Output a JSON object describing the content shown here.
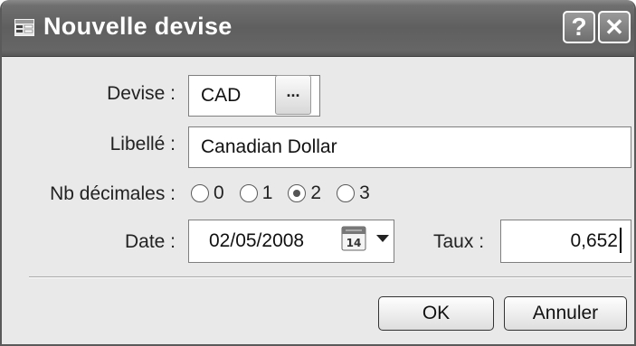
{
  "window": {
    "title": "Nouvelle devise"
  },
  "titlebar_buttons": {
    "help": "?",
    "close": "✕"
  },
  "form": {
    "devise": {
      "label": "Devise :",
      "value": "CAD",
      "lookup_button": "..."
    },
    "libelle": {
      "label": "Libellé :",
      "value": "Canadian Dollar"
    },
    "nb_decimales": {
      "label": "Nb décimales :",
      "options": [
        "0",
        "1",
        "2",
        "3"
      ],
      "selected": "2"
    },
    "date": {
      "label": "Date :",
      "value": "02/05/2008",
      "calendar_day": "14"
    },
    "taux": {
      "label": "Taux :",
      "value": "0,652"
    }
  },
  "buttons": {
    "ok": "OK",
    "annuler": "Annuler"
  }
}
